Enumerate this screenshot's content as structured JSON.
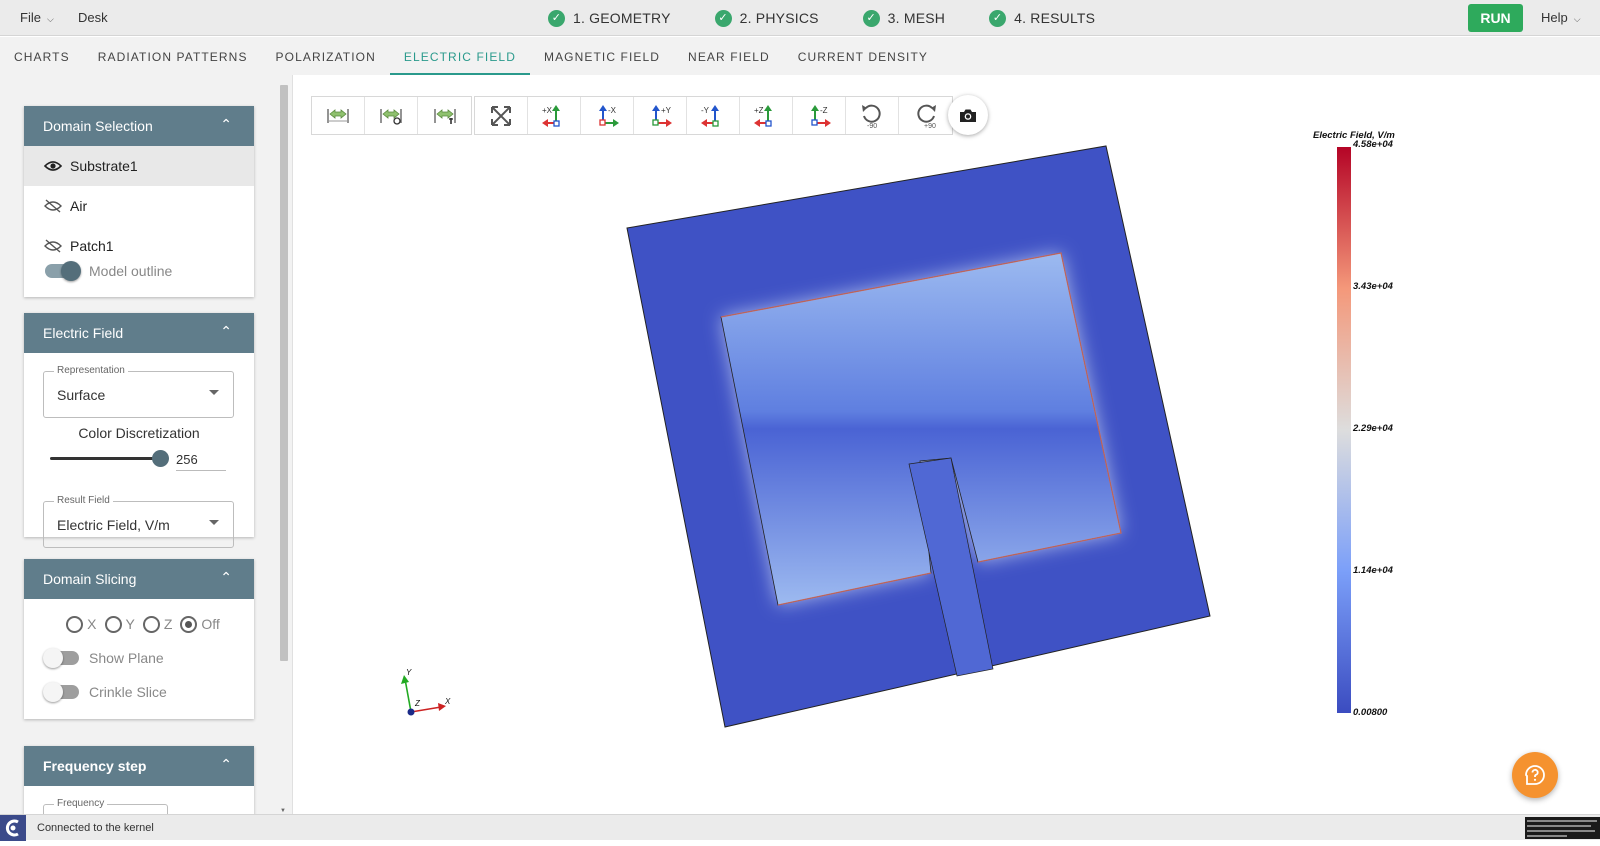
{
  "topbar": {
    "file_menu": "File",
    "desk_menu": "Desk",
    "steps": [
      {
        "label": "1. GEOMETRY"
      },
      {
        "label": "2. PHYSICS"
      },
      {
        "label": "3. MESH"
      },
      {
        "label": "4. RESULTS"
      }
    ],
    "run_label": "RUN",
    "help_menu": "Help"
  },
  "tabs": [
    {
      "label": "CHARTS"
    },
    {
      "label": "RADIATION PATTERNS"
    },
    {
      "label": "POLARIZATION"
    },
    {
      "label": "ELECTRIC FIELD",
      "active": true
    },
    {
      "label": "MAGNETIC FIELD"
    },
    {
      "label": "NEAR FIELD"
    },
    {
      "label": "CURRENT DENSITY"
    }
  ],
  "domain_selection": {
    "title": "Domain Selection",
    "items": [
      {
        "label": "Substrate1",
        "visible": true
      },
      {
        "label": "Air",
        "visible": false
      },
      {
        "label": "Patch1",
        "visible": false
      }
    ],
    "model_outline_label": "Model outline",
    "model_outline_on": true
  },
  "electric_field": {
    "title": "Electric Field",
    "representation_label": "Representation",
    "representation_value": "Surface",
    "color_discretization_label": "Color Discretization",
    "color_discretization_value": "256",
    "result_field_label": "Result Field",
    "result_field_value": "Electric Field, V/m"
  },
  "domain_slicing": {
    "title": "Domain Slicing",
    "axes": [
      "X",
      "Y",
      "Z",
      "Off"
    ],
    "selected": "Off",
    "show_plane_label": "Show Plane",
    "crinkle_slice_label": "Crinkle Slice"
  },
  "frequency_step": {
    "title": "Frequency step",
    "frequency_label": "Frequency"
  },
  "colorbar": {
    "title": "Electric Field, V/m",
    "ticks": [
      "4.58e+04",
      "3.43e+04",
      "2.29e+04",
      "1.14e+04",
      "0.00800"
    ]
  },
  "axes_triad": {
    "x": "X",
    "y": "Y",
    "z": "Z"
  },
  "toolbar_labels": {
    "plus_x": "+X",
    "minus_x": "-X",
    "plus_y": "+Y",
    "minus_y": "-Y",
    "plus_z": "+Z",
    "minus_z": "-Z",
    "rot_minus": "-90",
    "rot_plus": "+90"
  },
  "colors": {
    "accent": "#2a9a8c",
    "panel_header": "#607d8b",
    "run": "#2eaa5c",
    "check": "#3aa76d",
    "field_low": "#3b4cc0",
    "field_high": "#b40426",
    "help_fab": "#f5922f"
  },
  "status": {
    "message": "Connected to the kernel"
  }
}
